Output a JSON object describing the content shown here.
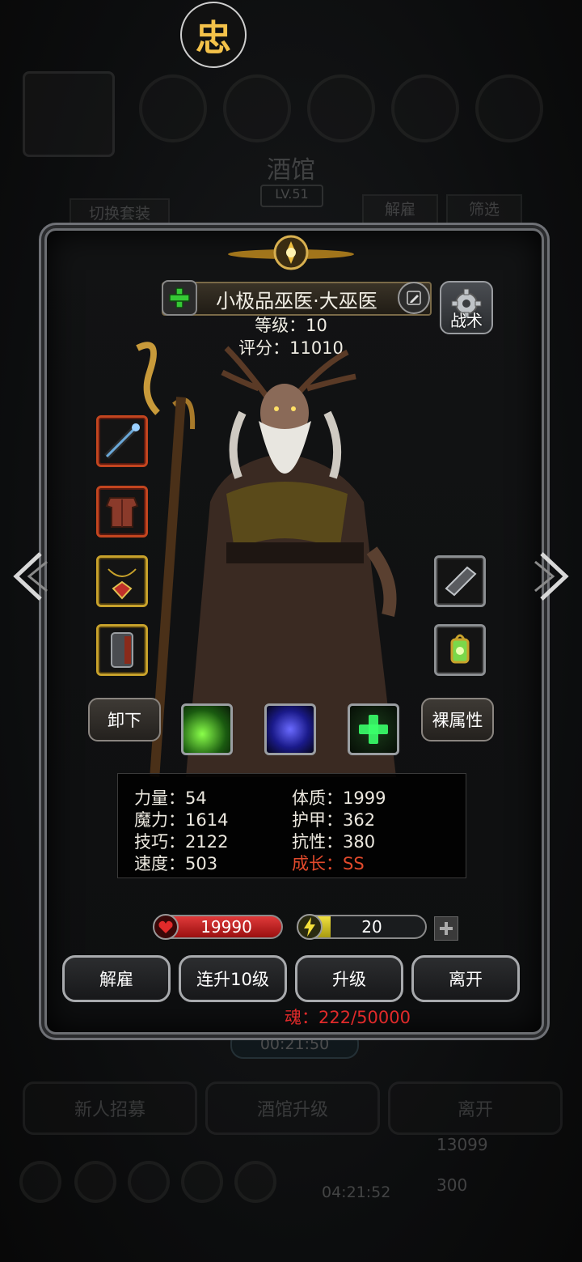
{
  "top_logo": "忠",
  "background": {
    "title": "酒馆",
    "level": "LV.51",
    "switch_outfit": "切换套装",
    "dismiss": "解雇",
    "filter": "筛选",
    "timer": "00:21:50",
    "recruit": "新人招募",
    "tavern_upgrade": "酒馆升级",
    "leave": "离开",
    "gold": "13099",
    "gift_timer": "04:21:52",
    "gems": "300"
  },
  "hero": {
    "name": "小极品巫医·大巫医",
    "level_line": "等级：10",
    "score_line": "评分：11010",
    "tactics_label": "战术"
  },
  "equipment": {
    "left": [
      {
        "icon": "staff-icon",
        "rarity": "red"
      },
      {
        "icon": "armor-icon",
        "rarity": "red"
      },
      {
        "icon": "amulet-icon",
        "rarity": "gold"
      },
      {
        "icon": "shield-icon",
        "rarity": "gold"
      }
    ],
    "right": [
      {
        "icon": "bracer-icon",
        "rarity": "grey"
      },
      {
        "icon": "lantern-icon",
        "rarity": "grey"
      }
    ]
  },
  "buttons": {
    "unequip": "卸下",
    "base_attributes": "裸属性"
  },
  "skills": [
    {
      "icon": "green-leaf-skill-icon",
      "color": "#2a8a2a"
    },
    {
      "icon": "blue-spirit-skill-icon",
      "color": "#2a2aa8"
    },
    {
      "icon": "green-heal-skill-icon",
      "color": "#1fa03a"
    }
  ],
  "stats": {
    "strength": "力量：54",
    "constitution": "体质：1999",
    "magic": "魔力：1614",
    "armor": "护甲：362",
    "skill": "技巧：2122",
    "resistance": "抗性：380",
    "speed": "速度：503",
    "growth": "成长：SS"
  },
  "hp": "19990",
  "energy": "20",
  "energy_fill": 0.25,
  "actions": {
    "dismiss": "解雇",
    "level_up_10": "连升10级",
    "level_up": "升级",
    "leave": "离开"
  },
  "soul": "魂：222/50000",
  "colors": {
    "gold": "#c8a22b",
    "rarity_red": "#c3451f",
    "hp_red": "#c81e1e",
    "energy_yellow": "#d6c21a",
    "growth_red": "#e24a2c"
  }
}
